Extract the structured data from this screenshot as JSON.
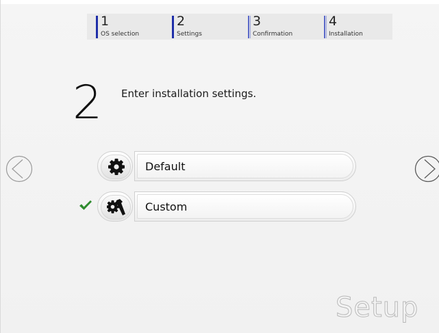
{
  "steps": [
    {
      "number": "1",
      "label": "OS selection"
    },
    {
      "number": "2",
      "label": "Settings"
    },
    {
      "number": "3",
      "label": "Confirmation"
    },
    {
      "number": "4",
      "label": "Installation"
    }
  ],
  "current_step": {
    "number": "2",
    "heading": "Enter installation settings."
  },
  "options": {
    "default": {
      "label": "Default",
      "icon": "gear-icon",
      "selected": false
    },
    "custom": {
      "label": "Custom",
      "icon": "wrench-gear-icon",
      "selected": true
    }
  },
  "navigation": {
    "prev_icon": "chevron-left-icon",
    "next_icon": "chevron-right-icon"
  },
  "brand_text": "Setup",
  "colors": {
    "step_bar": "#1f2ea8",
    "check": "#2e8b2e",
    "background": "#f3f3f3"
  }
}
